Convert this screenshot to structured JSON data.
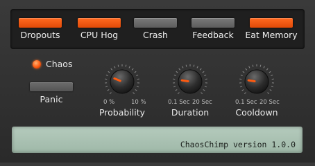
{
  "toggles": [
    {
      "label": "Dropouts",
      "state": "on"
    },
    {
      "label": "CPU Hog",
      "state": "on"
    },
    {
      "label": "Crash",
      "state": "off"
    },
    {
      "label": "Feedback",
      "state": "off"
    },
    {
      "label": "Eat Memory",
      "state": "on"
    }
  ],
  "chaos": {
    "label": "Chaos",
    "active": true
  },
  "panic": {
    "label": "Panic"
  },
  "knobs": [
    {
      "label": "Probability",
      "min_label": "0 %",
      "max_label": "10 %",
      "value_fraction": 0.25
    },
    {
      "label": "Duration",
      "min_label": "0.1 Sec",
      "max_label": "20 Sec",
      "value_fraction": 0.2
    },
    {
      "label": "Cooldown",
      "min_label": "0.1 Sec",
      "max_label": "20 Sec",
      "value_fraction": 0.2
    }
  ],
  "status": {
    "text": "ChaosChimp version 1.0.0"
  },
  "colors": {
    "accent": "#ff5a10",
    "inactive": "#6a6a6a"
  }
}
